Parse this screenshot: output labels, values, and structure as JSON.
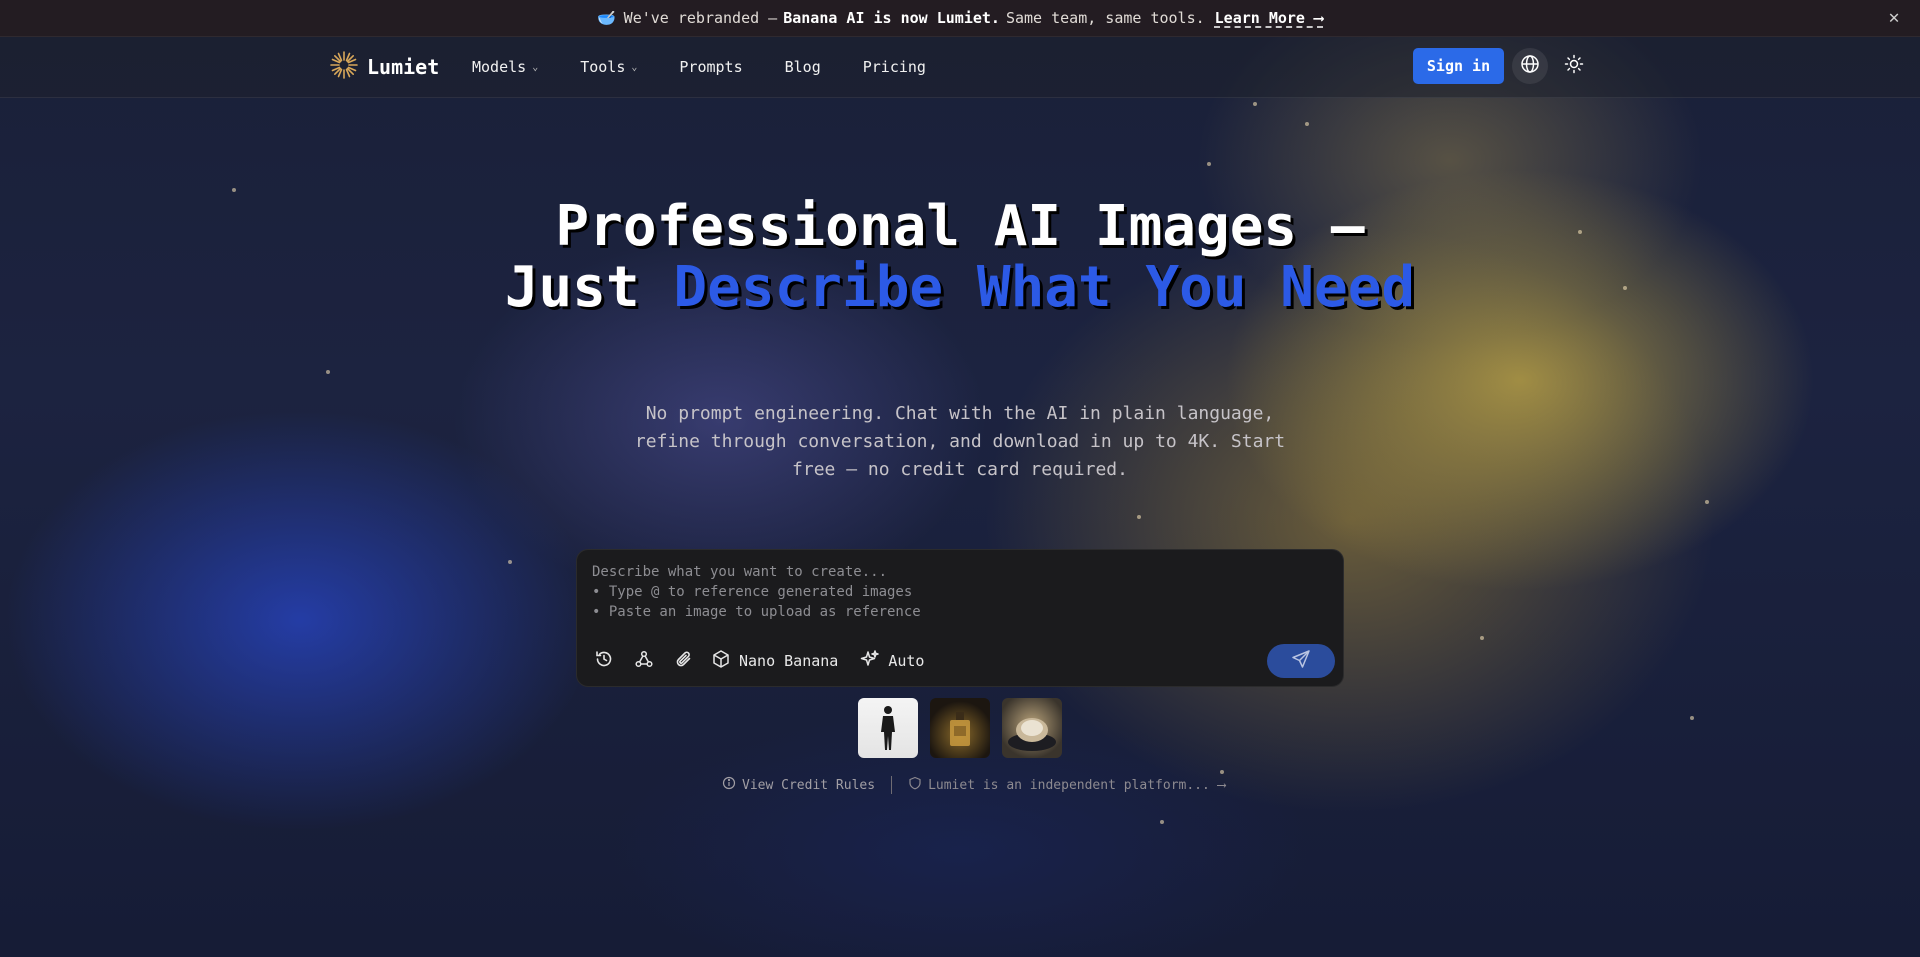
{
  "announcement": {
    "emoji": "🥣",
    "text_before": "We've rebranded —",
    "text_bold": "Banana AI is now Lumiet.",
    "text_after": "Same team, same tools.",
    "link_label": "Learn More ⟶",
    "close_glyph": "✕"
  },
  "nav": {
    "brand": "Lumiet",
    "links": [
      {
        "label": "Models",
        "has_dropdown": true
      },
      {
        "label": "Tools",
        "has_dropdown": true
      },
      {
        "label": "Prompts",
        "has_dropdown": false
      },
      {
        "label": "Blog",
        "has_dropdown": false
      },
      {
        "label": "Pricing",
        "has_dropdown": false
      }
    ],
    "chevron": "⌄",
    "signin_label": "Sign in"
  },
  "hero": {
    "title_line1": "Professional AI Images —",
    "title_just": "Just ",
    "title_accent": "Describe What You Need",
    "subtitle": "No prompt engineering. Chat with the AI in plain language, refine through conversation, and download in up to 4K. Start free — no credit card required."
  },
  "prompt": {
    "placeholder": "Describe what you want to create...\n• Type @ to reference generated images\n• Paste an image to upload as reference",
    "model_label": "Nano Banana",
    "ratio_label": "Auto"
  },
  "footer": {
    "credit_rules": "View Credit Rules",
    "disclaimer": "Lumiet is an independent platform... ⟶"
  },
  "colors": {
    "accent": "#2c5ae6",
    "signin": "#2b6ae8",
    "send": "#2b4c9c",
    "logo": "#d9a85a"
  },
  "icons": [
    "bowl-icon",
    "close-icon",
    "sunburst-logo-icon",
    "chevron-down-icon",
    "globe-icon",
    "sun-icon",
    "history-icon",
    "nodes-icon",
    "paperclip-icon",
    "cube-icon",
    "sparkles-icon",
    "send-icon",
    "info-icon",
    "shield-icon"
  ]
}
